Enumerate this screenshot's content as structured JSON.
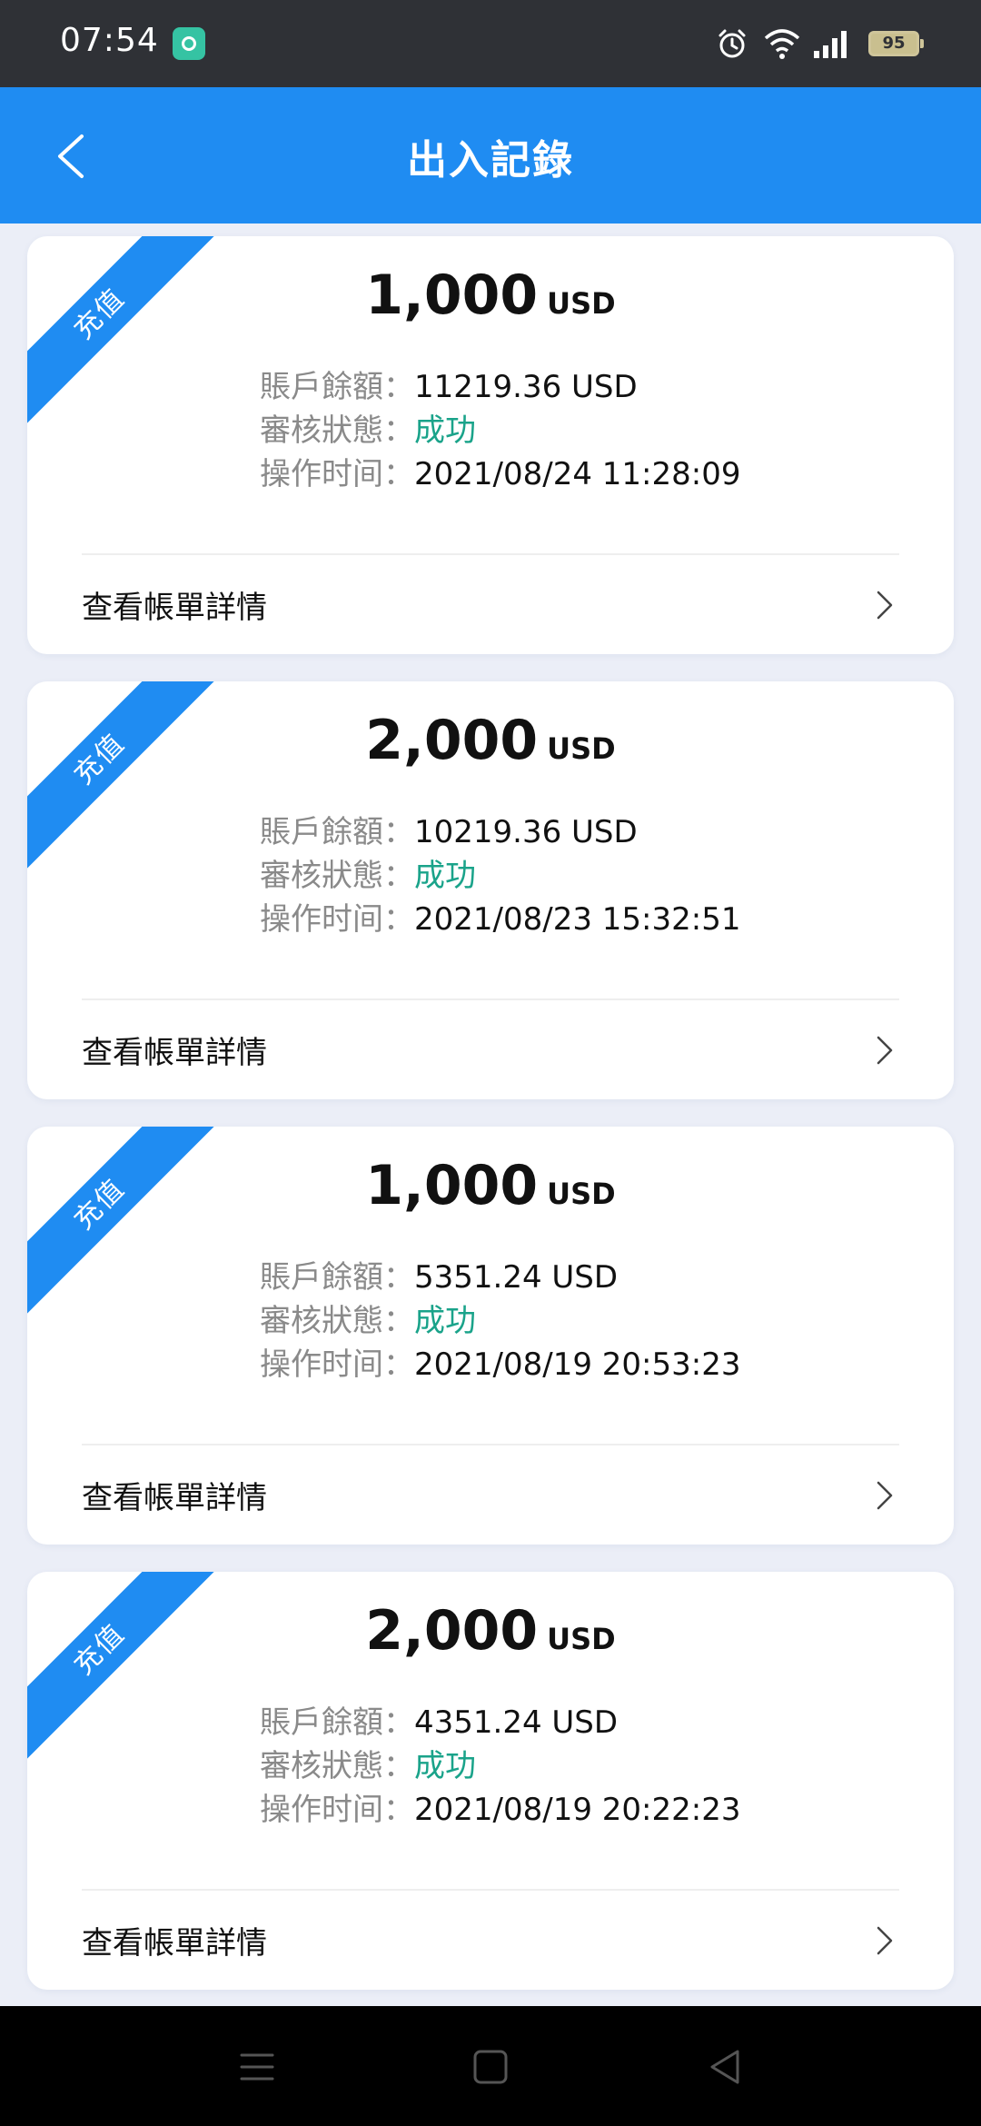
{
  "status_bar": {
    "time": "07:54",
    "battery": "95"
  },
  "header": {
    "title": "出入記錄"
  },
  "records": [
    {
      "ribbon": "充值",
      "amount": "1,000",
      "currency": "USD",
      "balance_label": "賬戶餘額：",
      "balance": "11219.36 USD",
      "status_label": "審核狀態：",
      "status": "成功",
      "time_label": "操作时间：",
      "time": "2021/08/24 11:28:09",
      "detail_label": "查看帳單詳情"
    },
    {
      "ribbon": "充值",
      "amount": "2,000",
      "currency": "USD",
      "balance_label": "賬戶餘額：",
      "balance": "10219.36 USD",
      "status_label": "審核狀態：",
      "status": "成功",
      "time_label": "操作时间：",
      "time": "2021/08/23 15:32:51",
      "detail_label": "查看帳單詳情"
    },
    {
      "ribbon": "充值",
      "amount": "1,000",
      "currency": "USD",
      "balance_label": "賬戶餘額：",
      "balance": "5351.24 USD",
      "status_label": "審核狀態：",
      "status": "成功",
      "time_label": "操作时间：",
      "time": "2021/08/19 20:53:23",
      "detail_label": "查看帳單詳情"
    },
    {
      "ribbon": "充值",
      "amount": "2,000",
      "currency": "USD",
      "balance_label": "賬戶餘額：",
      "balance": "4351.24 USD",
      "status_label": "審核狀態：",
      "status": "成功",
      "time_label": "操作时间：",
      "time": "2021/08/19 20:22:23",
      "detail_label": "查看帳單詳情"
    }
  ],
  "colors": {
    "header": "#1f8cf2",
    "success": "#1aa38a",
    "background": "#ebeef7"
  }
}
